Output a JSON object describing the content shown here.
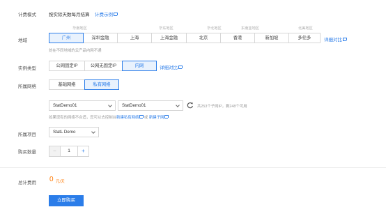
{
  "billing": {
    "label": "计费模式",
    "value": "按实际天数每月结算",
    "link": "计费示例"
  },
  "region": {
    "label": "地域",
    "groups": [
      "华南地区",
      "华东地区",
      "华北地区",
      "东南亚地区",
      "北美地区"
    ],
    "options": [
      "广州",
      "深圳金融",
      "上海",
      "上海金融",
      "北京",
      "香港",
      "新加坡",
      "多伦多"
    ],
    "selected": "广州",
    "compare_link": "详细对比",
    "hint": "处在不同地域的云产品内网不通"
  },
  "instance_type": {
    "label": "实例类型",
    "options": [
      "公网固定IP",
      "公网无固定IP",
      "内网"
    ],
    "selected": "内网",
    "compare_link": "详细对比"
  },
  "network": {
    "label": "所属网络",
    "options": [
      "基础网络",
      "私有网络"
    ],
    "selected": "私有网络",
    "vpc_select": "StatDemo01",
    "subnet_select": "StatDemo01",
    "subnet_info": "共253个子网IP，剩248个可用",
    "hint_prefix": "如果现有的网络不合适，您可以去控制台",
    "new_vpc_link": "新建私有网络",
    "or": "或",
    "new_subnet_link": "新建子网"
  },
  "project": {
    "label": "所属项目",
    "value": "StatL Demo"
  },
  "quantity": {
    "label": "购买数量",
    "minus": "−",
    "value": "1",
    "plus": "+"
  },
  "total": {
    "label": "总计费用",
    "amount": "0",
    "unit": "元/天"
  },
  "buy_button": "立即购买",
  "colors": {
    "accent": "#2b7de9",
    "price": "#ff7800",
    "active_bg": "#e9f2fd"
  },
  "icons": {
    "refresh": "refresh-icon",
    "external": "external-link-icon",
    "caret": "chevron-down-icon"
  }
}
